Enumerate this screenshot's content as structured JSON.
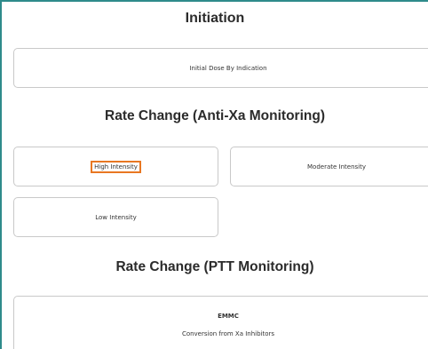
{
  "sections": {
    "initiation": {
      "title": "Initiation",
      "initial_dose": "Initial Dose By Indication"
    },
    "anti_xa": {
      "title": "Rate Change (Anti-Xa Monitoring)",
      "high": "High Intensity",
      "moderate": "Moderate Intensity",
      "low": "Low Intensity"
    },
    "ptt": {
      "title": "Rate Change (PTT Monitoring)",
      "emmc_title": "EMMC",
      "emmc_subtitle": "Conversion from Xa Inhibitors"
    }
  },
  "colors": {
    "frame_border": "#2e8b8b",
    "highlight": "#e87722"
  }
}
